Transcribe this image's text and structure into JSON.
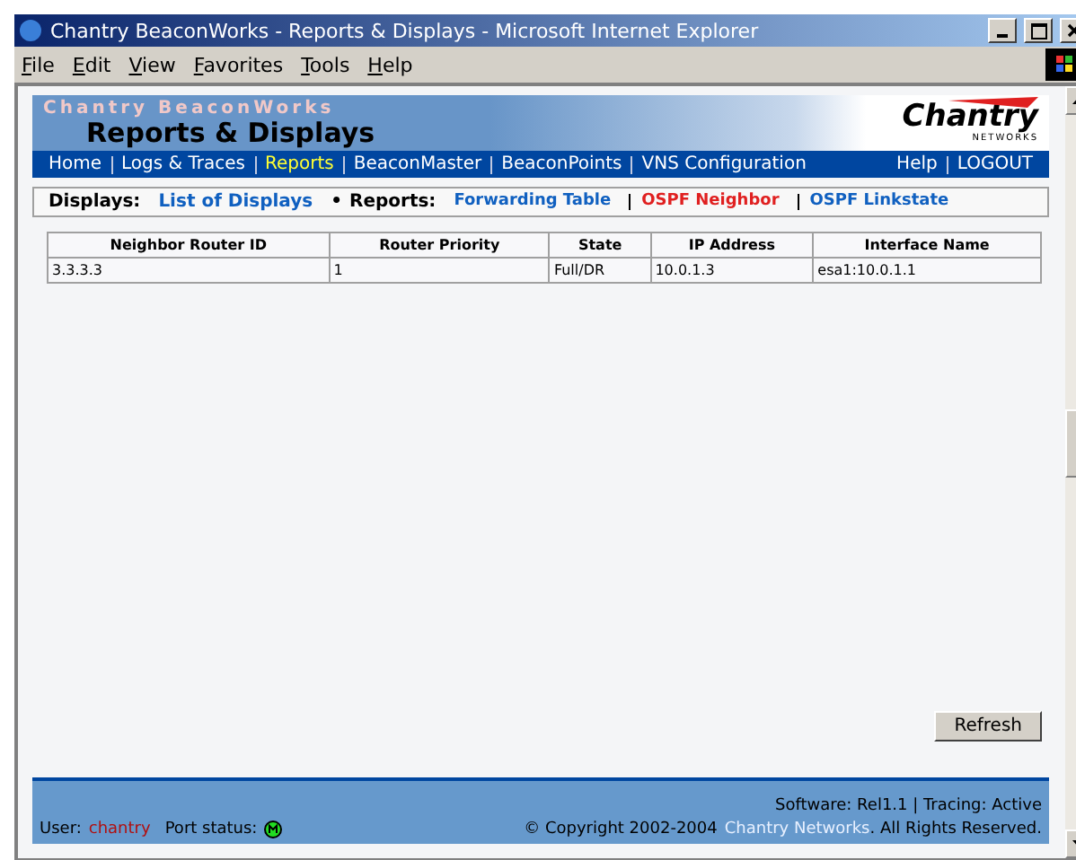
{
  "window": {
    "title": "Chantry BeaconWorks - Reports & Displays - Microsoft Internet Explorer"
  },
  "menu": [
    "File",
    "Edit",
    "View",
    "Favorites",
    "Tools",
    "Help"
  ],
  "banner": {
    "product": "Chantry BeaconWorks",
    "title": "Reports & Displays",
    "logo": "Chantry",
    "logo_sub": "NETWORKS"
  },
  "nav": {
    "items": [
      {
        "label": "Home",
        "selected": false
      },
      {
        "label": "Logs & Traces",
        "selected": false
      },
      {
        "label": "Reports",
        "selected": true
      },
      {
        "label": "BeaconMaster",
        "selected": false
      },
      {
        "label": "BeaconPoints",
        "selected": false
      },
      {
        "label": "VNS Configuration",
        "selected": false
      }
    ],
    "right": [
      "Help",
      "LOGOUT"
    ]
  },
  "subnav": {
    "displays_label": "Displays:",
    "displays": [
      "List of Displays"
    ],
    "bullet": "•",
    "reports_label": "Reports:",
    "reports": [
      {
        "label": "Forwarding Table",
        "selected": false
      },
      {
        "label": "OSPF Neighbor",
        "selected": true
      },
      {
        "label": "OSPF Linkstate",
        "selected": false
      }
    ]
  },
  "table": {
    "columns": [
      "Neighbor Router ID",
      "Router Priority",
      "State",
      "IP Address",
      "Interface Name"
    ],
    "rows": [
      [
        "3.3.3.3",
        "1",
        "Full/DR",
        "10.0.1.3",
        "esa1:10.0.1.1"
      ]
    ]
  },
  "refresh_button": "Refresh",
  "footer": {
    "software": "Software: Rel1.1 | Tracing: Active",
    "user_label": "User:",
    "user": "chantry",
    "port_label": "Port status:",
    "copyright": "© Copyright 2002-2004",
    "company": "Chantry Networks",
    "rights": ". All Rights Reserved."
  }
}
